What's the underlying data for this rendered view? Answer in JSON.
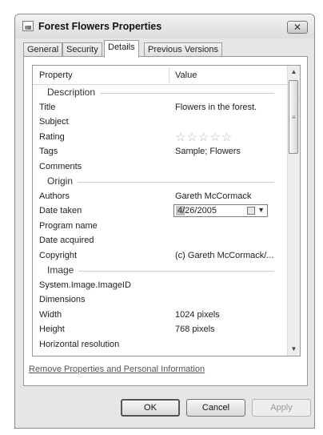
{
  "window": {
    "title": "Forest Flowers Properties",
    "close_label": "✕"
  },
  "tabs": [
    {
      "label": "General"
    },
    {
      "label": "Security"
    },
    {
      "label": "Details",
      "active": true
    },
    {
      "label": "Previous Versions"
    }
  ],
  "list": {
    "headers": {
      "property": "Property",
      "value": "Value"
    },
    "groups": {
      "description": "Description",
      "origin": "Origin",
      "image": "Image"
    },
    "rows": {
      "title": {
        "property": "Title",
        "value": "Flowers in the forest."
      },
      "subject": {
        "property": "Subject",
        "value": ""
      },
      "rating": {
        "property": "Rating",
        "value": "☆☆☆☆☆",
        "stars": 0
      },
      "tags": {
        "property": "Tags",
        "value": "Sample; Flowers"
      },
      "comments": {
        "property": "Comments",
        "value": ""
      },
      "authors": {
        "property": "Authors",
        "value": "Gareth McCormack"
      },
      "date_taken": {
        "property": "Date taken",
        "value": "4/26/2005"
      },
      "program_name": {
        "property": "Program name",
        "value": ""
      },
      "date_acquired": {
        "property": "Date acquired",
        "value": ""
      },
      "copyright": {
        "property": "Copyright",
        "value": "(c) Gareth McCormack/..."
      },
      "image_id": {
        "property": "System.Image.ImageID",
        "value": ""
      },
      "dimensions": {
        "property": "Dimensions",
        "value": ""
      },
      "width": {
        "property": "Width",
        "value": "1024 pixels"
      },
      "height": {
        "property": "Height",
        "value": "768 pixels"
      },
      "horizontal_resolution": {
        "property": "Horizontal resolution",
        "value": ""
      }
    }
  },
  "link": {
    "remove_properties": "Remove Properties and Personal Information"
  },
  "buttons": {
    "ok": "OK",
    "cancel": "Cancel",
    "apply": "Apply"
  },
  "icons": {
    "app": "image-file-icon",
    "calendar": "calendar-icon",
    "dropdown": "chevron-down-icon",
    "scroll_up": "scroll-up-arrow-icon",
    "scroll_down": "scroll-down-arrow-icon"
  }
}
